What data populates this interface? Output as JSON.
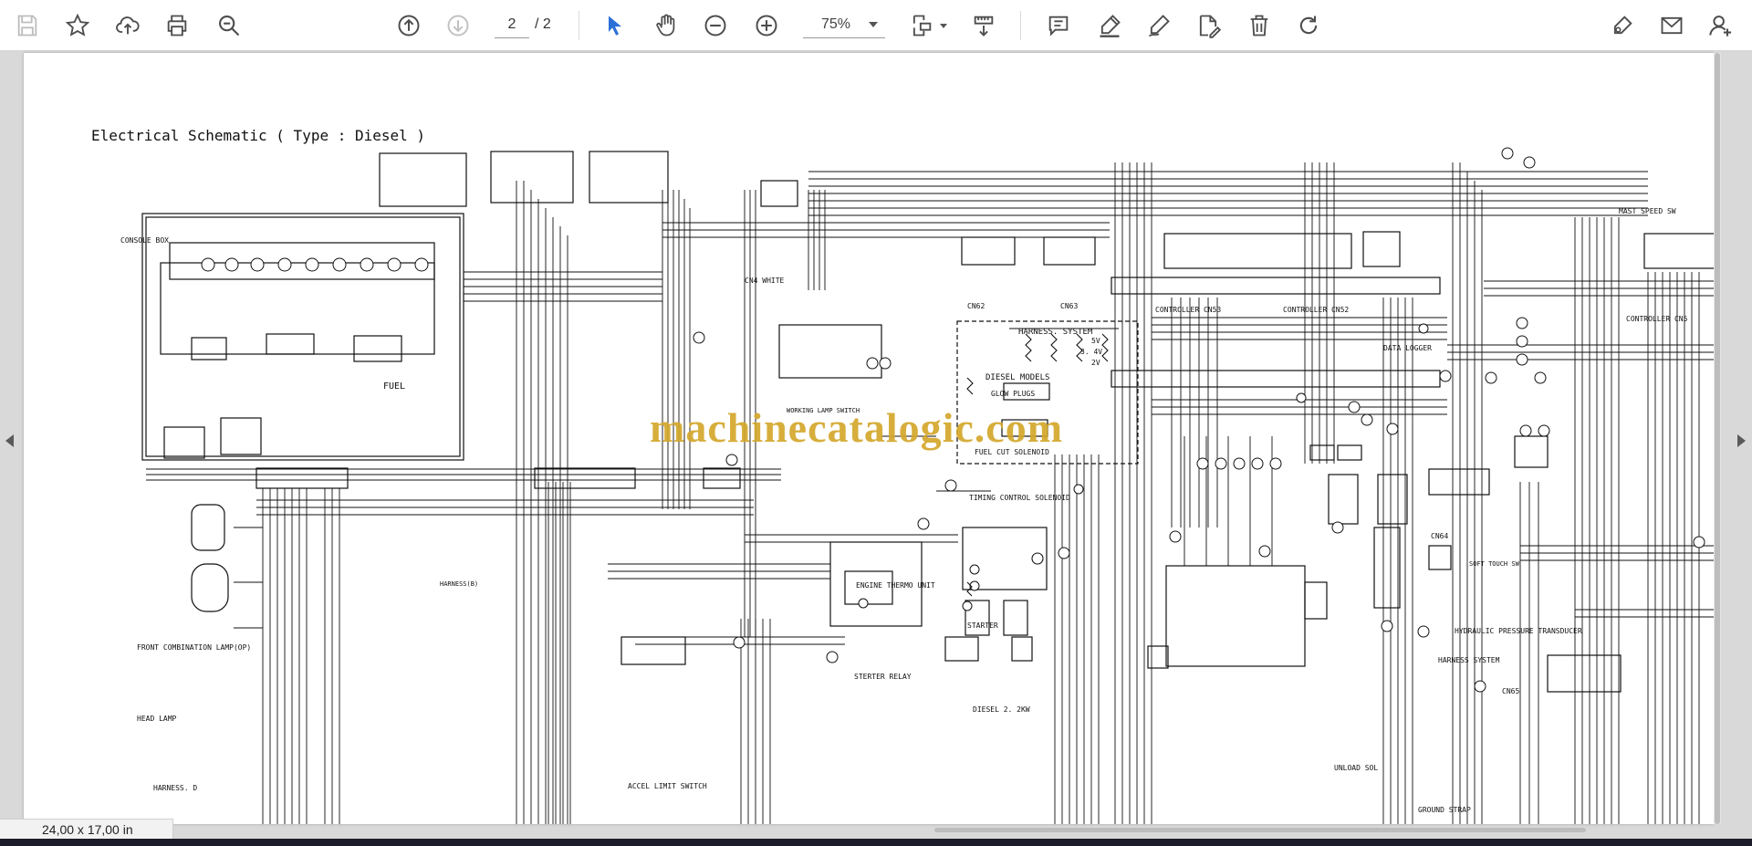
{
  "toolbar": {
    "page_current": "2",
    "page_total": "/ 2",
    "zoom": "75%"
  },
  "document": {
    "title": "Electrical Schematic ( Type : Diesel )",
    "watermark": "machinecatalogic.com",
    "labels": {
      "console_box": "CONSOLE BOX",
      "front_lamp": "FRONT COMBINATION LAMP(OP)",
      "head_lamp": "HEAD LAMP",
      "harness_d": "HARNESS. D",
      "harness_system": "HARNESS. SYSTEM",
      "diesel_models": "DIESEL MODELS",
      "glow_plugs": "GLOW PLUGS",
      "fuel_cut": "FUEL CUT SOLENOID",
      "timing_control": "TIMING CONTROL SOLENOID",
      "engine_thermo": "ENGINE THERMO UNIT",
      "starter": "STARTER",
      "starter_relay": "STERTER RELAY",
      "diesel_kw": "DIESEL 2. 2KW",
      "accel_limit": "ACCEL LIMIT SWITCH",
      "controller_cn53": "CONTROLLER CN53",
      "controller_cn52": "CONTROLLER CN52",
      "controller_cn5": "CONTROLLER CN5",
      "data_logger": "DATA LOGGER",
      "mast_speed": "MAST SPEED SW",
      "cn4_white": "CN4 WHITE",
      "cn62": "CN62",
      "cn63": "CN63",
      "cn64": "CN64",
      "cn65": "CN65",
      "hyd_pressure": "HYDRAULIC PRESSURE TRANSDUCER",
      "harness_system2": "HARNESS SYSTEM",
      "unload_sol": "UNLOAD SOL",
      "ground_strap": "GROUND STRAP",
      "working_lamp": "WORKING LAMP SWITCH",
      "fuel": "FUEL",
      "soft_touch": "SOFT TOUCH SW",
      "harness_1b": "HARNESS(B)",
      "v5": "5V",
      "v34": "3. 4V",
      "v2": "2V"
    }
  },
  "status": {
    "page_size": "24,00 x 17,00 in"
  }
}
